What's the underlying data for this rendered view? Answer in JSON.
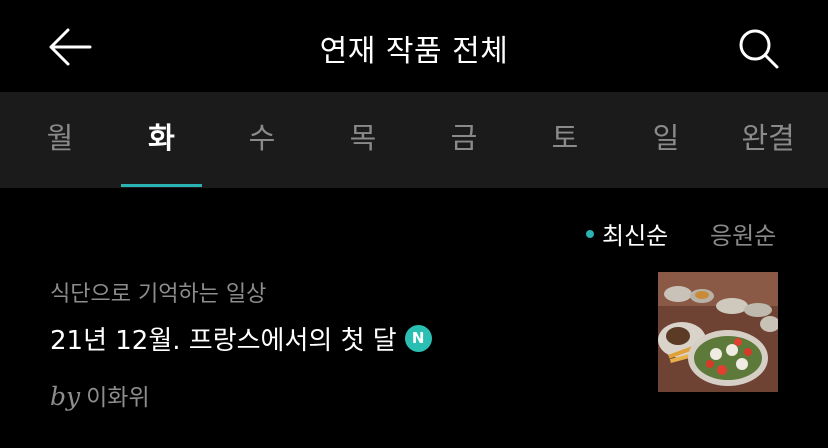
{
  "header": {
    "title": "연재 작품 전체",
    "back_icon": "arrow-left-icon",
    "search_icon": "search-icon"
  },
  "tabs": [
    {
      "label": "월",
      "active": false
    },
    {
      "label": "화",
      "active": true
    },
    {
      "label": "수",
      "active": false
    },
    {
      "label": "목",
      "active": false
    },
    {
      "label": "금",
      "active": false
    },
    {
      "label": "토",
      "active": false
    },
    {
      "label": "일",
      "active": false
    },
    {
      "label": "완결",
      "active": false
    }
  ],
  "sort": {
    "latest_label": "최신순",
    "cheer_label": "응원순",
    "selected": "최신순"
  },
  "articles": [
    {
      "series": "식단으로 기억하는 일상",
      "title": "21년 12월. 프랑스에서의 첫 달",
      "badge": "N",
      "by_label": "by",
      "author": "이화위"
    }
  ],
  "colors": {
    "accent": "#2bb3b3",
    "badge": "#2bbfb3",
    "background": "#000000",
    "tab_bar": "#1b1b1b",
    "muted_text": "#8a8a8a"
  }
}
